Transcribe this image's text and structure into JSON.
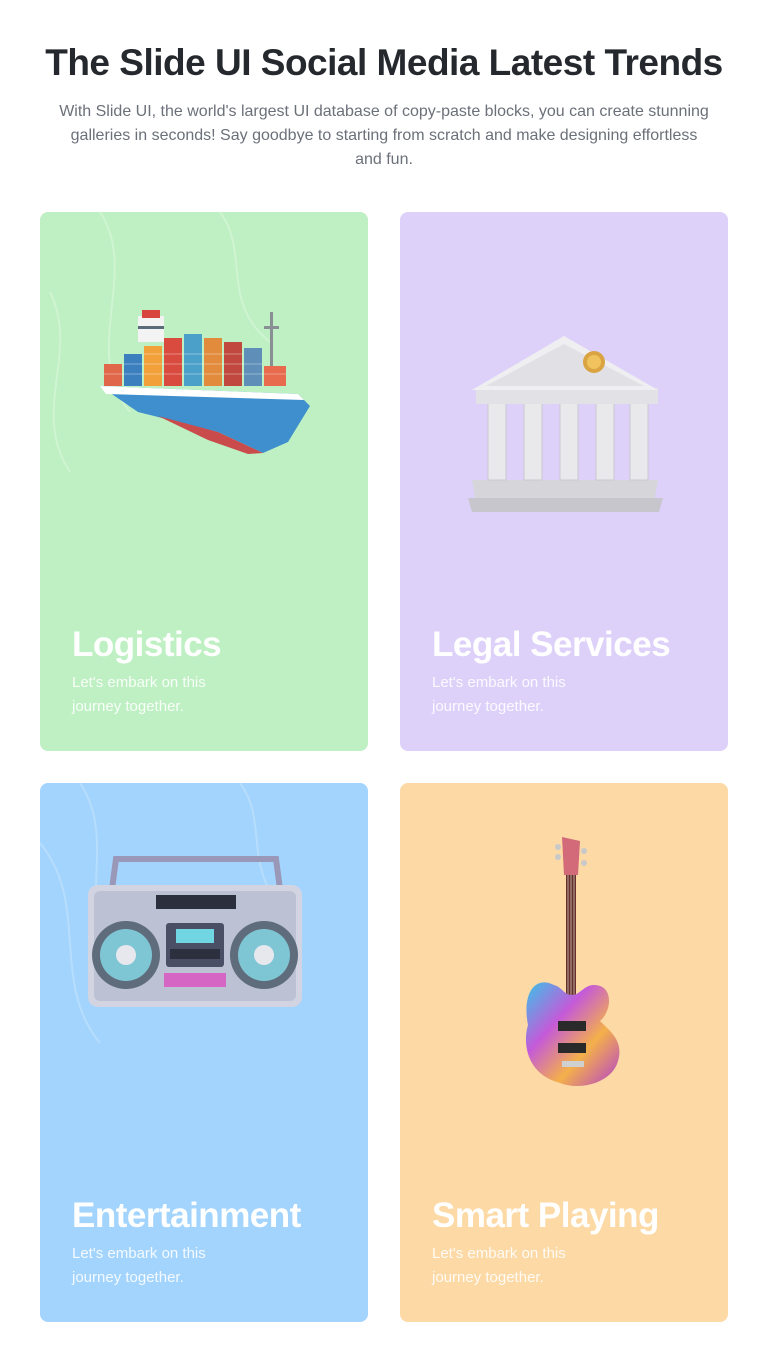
{
  "header": {
    "title": "The Slide UI Social Media Latest Trends",
    "subtitle": "With Slide UI, the world's largest UI database of copy-paste blocks, you can create stunning galleries in seconds! Say goodbye to starting from scratch and make designing effortless and fun."
  },
  "cards": [
    {
      "title": "Logistics",
      "description": "Let's embark on this journey together.",
      "color": "#bff0c3",
      "image": "cargo-ship-illustration"
    },
    {
      "title": "Legal Services",
      "description": "Let's embark on this journey together.",
      "color": "#ddd1fa",
      "image": "courthouse-illustration"
    },
    {
      "title": "Entertainment",
      "description": "Let's embark on this journey together.",
      "color": "#a3d4fd",
      "image": "boombox-illustration"
    },
    {
      "title": "Smart Playing",
      "description": "Let's embark on this journey together.",
      "color": "#fcd9a5",
      "image": "bass-guitar-illustration"
    }
  ]
}
